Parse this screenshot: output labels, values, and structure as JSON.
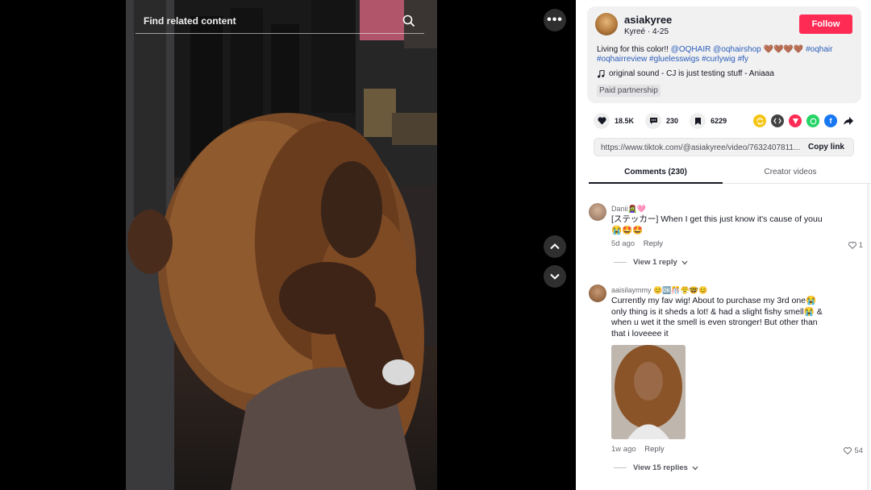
{
  "video": {
    "search_placeholder": "Find related content",
    "more_label": "•••"
  },
  "author": {
    "username": "asiakyree",
    "display_name": "Kyreé",
    "date": "4-25",
    "follow_label": "Follow"
  },
  "caption": {
    "text": "Living for this color!!",
    "mention1": "@OQHAIR",
    "mention2": "@oqhairshop",
    "hearts": "🤎🤎🤎🤎",
    "tag1": "#oqhair",
    "tag2": "#oqhairreview",
    "tag3": "#gluelesswigs",
    "tag4": "#curlywig",
    "tag5": "#fy"
  },
  "music": {
    "icon": "music-note-icon",
    "text": "original sound - CJ is just testing stuff - Aniaaa"
  },
  "paid_label": "Paid partnership",
  "stats": {
    "likes": "18.5K",
    "comments": "230",
    "saves": "6229"
  },
  "share_icons": [
    {
      "name": "repost-icon",
      "color": "#f5c518"
    },
    {
      "name": "embed-icon",
      "color": "#444444"
    },
    {
      "name": "send-icon",
      "color": "#fe2c55"
    },
    {
      "name": "whatsapp-icon",
      "color": "#25d366"
    },
    {
      "name": "facebook-icon",
      "color": "#1877f2"
    },
    {
      "name": "share-arrow-icon",
      "color": "#161823"
    }
  ],
  "link": {
    "url": "https://www.tiktok.com/@asiakyree/video/7632407811...",
    "copy_label": "Copy link"
  },
  "tabs": {
    "comments": "Comments (230)",
    "creator": "Creator videos"
  },
  "comments": [
    {
      "user": "Danii🧟‍♀️🩷",
      "text": "[ステッカー] When I get this just know it's cause of youu 😭🤩🤩",
      "time": "5d ago",
      "reply_label": "Reply",
      "likes": "1",
      "view_replies": "View 1 reply"
    },
    {
      "user": "aaisilaymmy 😊🆗🎊😤🤓😊",
      "text": "Currently my fav wig! About to purchase my 3rd one😭 only thing is it sheds a lot! & had a slight fishy smell😭 & when u wet it the smell is even stronger! But other than that i loveeee it",
      "time": "1w ago",
      "reply_label": "Reply",
      "likes": "54",
      "view_replies": "View 15 replies"
    }
  ]
}
